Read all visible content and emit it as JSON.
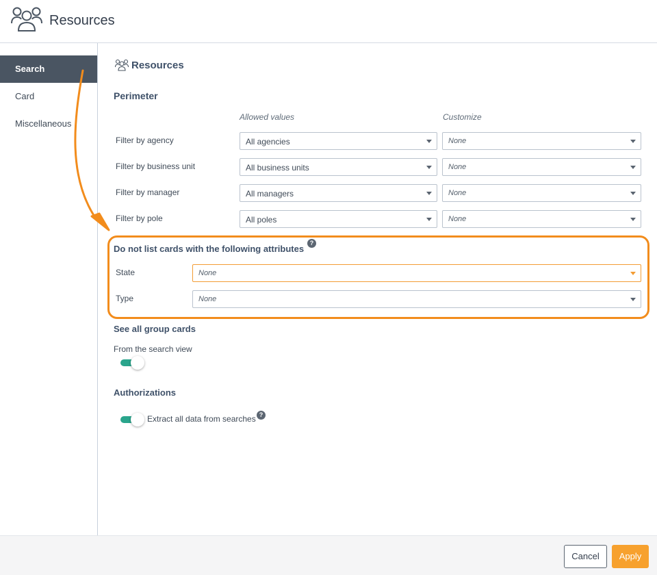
{
  "header": {
    "title": "Resources",
    "icon": "users-icon"
  },
  "sidebar": {
    "items": [
      {
        "label": "Search",
        "active": true
      },
      {
        "label": "Card",
        "active": false
      },
      {
        "label": "Miscellaneous",
        "active": false
      }
    ]
  },
  "main": {
    "panel_title": "Resources",
    "perimeter": {
      "title": "Perimeter",
      "col_allowed": "Allowed values",
      "col_customize": "Customize",
      "rows": [
        {
          "label": "Filter by agency",
          "allowed": "All agencies",
          "customize": "None"
        },
        {
          "label": "Filter by business unit",
          "allowed": "All business units",
          "customize": "None"
        },
        {
          "label": "Filter by manager",
          "allowed": "All managers",
          "customize": "None"
        },
        {
          "label": "Filter by pole",
          "allowed": "All poles",
          "customize": "None"
        }
      ]
    },
    "exclude": {
      "title": "Do not list cards with the following attributes",
      "help": "?",
      "state_label": "State",
      "state_value": "None",
      "type_label": "Type",
      "type_value": "None"
    },
    "group_cards": {
      "title": "See all group cards",
      "from_search_label": "From the search view",
      "from_search_on": true
    },
    "authorizations": {
      "title": "Authorizations",
      "extract_label": "Extract all data from searches",
      "extract_on": true,
      "help": "?"
    }
  },
  "footer": {
    "cancel": "Cancel",
    "apply": "Apply"
  },
  "colors": {
    "accent": "#f7a12e",
    "highlight": "#f28c1c",
    "toggle_on": "#2aa58c",
    "sidebar_active": "#4a5562"
  }
}
